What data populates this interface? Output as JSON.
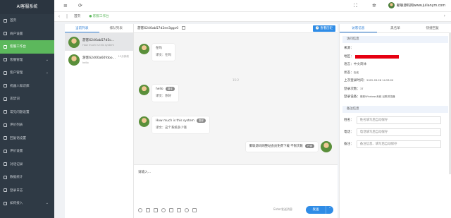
{
  "app": {
    "title": "AI客服系统"
  },
  "sidebar": {
    "items": [
      {
        "label": "首页",
        "icon": "home-icon",
        "active": false,
        "expandable": false
      },
      {
        "label": "商户设置",
        "icon": "settings-icon",
        "active": false,
        "expandable": false
      },
      {
        "label": "客服工作台",
        "icon": "desk-icon",
        "active": true,
        "expandable": false
      },
      {
        "label": "客服管理",
        "icon": "agent-icon",
        "active": false,
        "expandable": true
      },
      {
        "label": "客户管理",
        "icon": "customer-icon",
        "active": false,
        "expandable": true
      },
      {
        "label": "机器人知识库",
        "icon": "robot-icon",
        "active": false,
        "expandable": false
      },
      {
        "label": "违禁词",
        "icon": "block-icon",
        "active": false,
        "expandable": false
      },
      {
        "label": "常见问题设置",
        "icon": "faq-icon",
        "active": false,
        "expandable": false
      },
      {
        "label": "评价列表",
        "icon": "rating-icon",
        "active": false,
        "expandable": false
      },
      {
        "label": "回复语设置",
        "icon": "reply-icon",
        "active": false,
        "expandable": false
      },
      {
        "label": "评价设置",
        "icon": "star-icon",
        "active": false,
        "expandable": false
      },
      {
        "label": "对话记录",
        "icon": "record-icon",
        "active": false,
        "expandable": false
      },
      {
        "label": "数据统计",
        "icon": "stats-icon",
        "active": false,
        "expandable": false
      },
      {
        "label": "登录日志",
        "icon": "log-icon",
        "active": false,
        "expandable": false
      },
      {
        "label": "如何接入",
        "icon": "link-icon",
        "active": false,
        "expandable": true
      }
    ]
  },
  "topbar": {
    "icons": [
      "menu-icon",
      "refresh-icon",
      "fullscreen-icon",
      "settings-icon"
    ],
    "user": "聚联源码网www.julianym.com"
  },
  "breadcrumb": {
    "home": "首页",
    "current": "客服工作台"
  },
  "conversations": {
    "tabs": [
      "当前列表",
      "排队列表"
    ],
    "items": [
      {
        "name": "游客6240ab57d5c...",
        "snippet": "How much is this system",
        "time": "",
        "active": true
      },
      {
        "name": "游客62400a60fdoo...",
        "snippet": "hello",
        "time": "12分钟前",
        "active": false
      }
    ]
  },
  "chat": {
    "header": "游客6240ab57d2ee3ggc0",
    "history_button": "查看历史",
    "timestamp": "15:2",
    "messages": [
      {
        "text": "在吗",
        "translation": "译文：在吗",
        "tag": ""
      },
      {
        "text": "hello",
        "translation": "译文：你好",
        "tag": "翻译"
      },
      {
        "text": "How much is this system",
        "translation": "译文：这个系统多少钱",
        "tag": "翻译"
      }
    ],
    "self_message": {
      "text": "聚联源码网整站会员免费下载 不限次数",
      "tag": "已读"
    },
    "input_placeholder": "请输入...",
    "hint": "Enter发送消息",
    "send_label": "发送",
    "accent": "#2f8ce6",
    "active_green": "#5cb85c"
  },
  "visitor": {
    "tabs": [
      "访客信息",
      "黑名单",
      "快捷回复"
    ],
    "section_access": "访问信息",
    "fields": [
      {
        "label": "来源：",
        "value": "",
        "small": false
      },
      {
        "label": "地区：",
        "value": "",
        "redacted": true
      },
      {
        "label": "语言：",
        "value": "中文简体",
        "small": false
      },
      {
        "label": "状态：",
        "value": "在线",
        "small": true
      },
      {
        "label": "上次登录时间：",
        "value": "2022-03-28 14:53:20",
        "small": true
      },
      {
        "label": "登录次数：",
        "value": "37",
        "small": true
      },
      {
        "label": "登录设备：",
        "value": "微软Windows系统 谷歌浏览器",
        "small": true
      }
    ],
    "section_notes": "备注信息",
    "inputs": [
      {
        "label": "姓名：",
        "placeholder": "姓名填写后自动保存"
      },
      {
        "label": "电话：",
        "placeholder": "电话填写后自动保存"
      },
      {
        "label": "备注：",
        "placeholder": "备注信息、填写后自动保存"
      }
    ]
  }
}
